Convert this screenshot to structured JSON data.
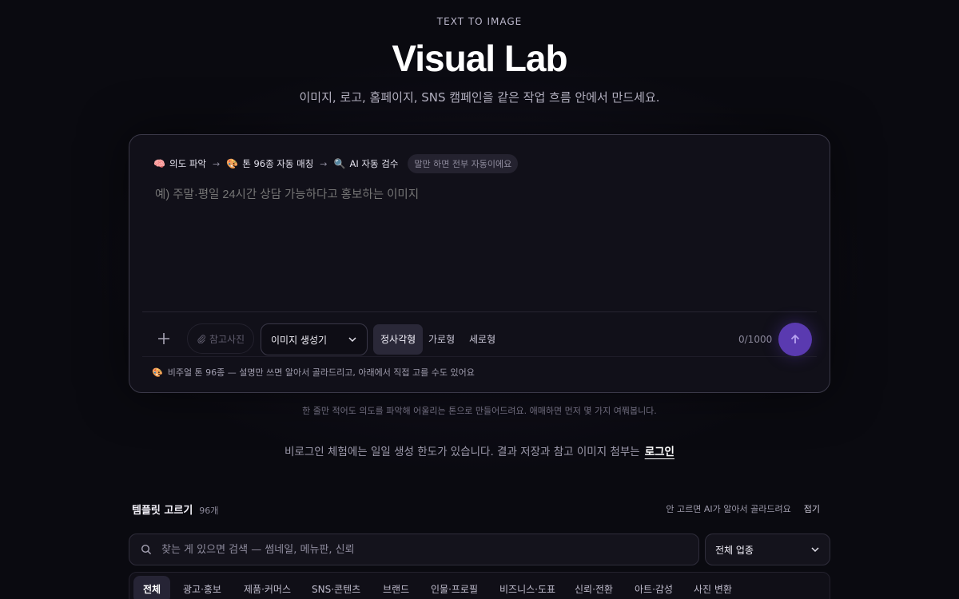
{
  "header": {
    "eyebrow": "TEXT TO IMAGE",
    "title": "Visual Lab",
    "subtitle": "이미지, 로고, 홈페이지, SNS 캠페인을 같은 작업 흐름 안에서 만드세요."
  },
  "composer": {
    "pipeline": {
      "step1_icon": "brain-emoji",
      "step1_glyph": "🧠",
      "step1_label": "의도 파악",
      "step2_icon": "palette-emoji",
      "step2_glyph": "🎨",
      "step2_label": "톤 96종 자동 매칭",
      "step3_icon": "magnifier-emoji",
      "step3_glyph": "🔍",
      "step3_label": "AI 자동 검수",
      "arrow": "→",
      "note": "말만 하면 전부 자동이에요"
    },
    "prompt_placeholder": "예) 주말·평일 24시간 상담 가능하다고 홍보하는 이미지",
    "prompt_value": "",
    "reference_label": "참고사진",
    "mode_value": "이미지 생성기",
    "ratios": [
      "정사각형",
      "가로형",
      "세로형"
    ],
    "active_ratio": "정사각형",
    "counter": "0/1000",
    "tone_note": "비주얼 톤 96종 — 설명만 쓰면 알아서 골라드리고, 아래에서 직접 고를 수도 있어요"
  },
  "hint": "한 줄만 적어도 의도를 파악해 어울리는 톤으로 만들어드려요. 애매하면 먼저 몇 가지 여쭤봅니다.",
  "login_notice": {
    "text": "비로그인 체험에는 일일 생성 한도가 있습니다. 결과 저장과 참고 이미지 첨부는",
    "link": "로그인"
  },
  "templates": {
    "title": "템플릿 고르기",
    "count": "96개",
    "auto_note": "안 고르면 AI가 알아서 골라드려요",
    "collapse": "접기",
    "search_placeholder": "찾는 게 있으면 검색 — 썸네일, 메뉴판, 신뢰",
    "search_value": "",
    "industry_value": "전체 업종",
    "categories": [
      "전체",
      "광고·홍보",
      "제품·커머스",
      "SNS·콘텐츠",
      "브랜드",
      "인물·프로필",
      "비즈니스·도표",
      "신뢰·전환",
      "아트·감성",
      "사진 변환"
    ],
    "active_category": "전체"
  },
  "colors": {
    "background": "#0a0a10",
    "accent": "#5a3ab0",
    "card": "#111019"
  }
}
